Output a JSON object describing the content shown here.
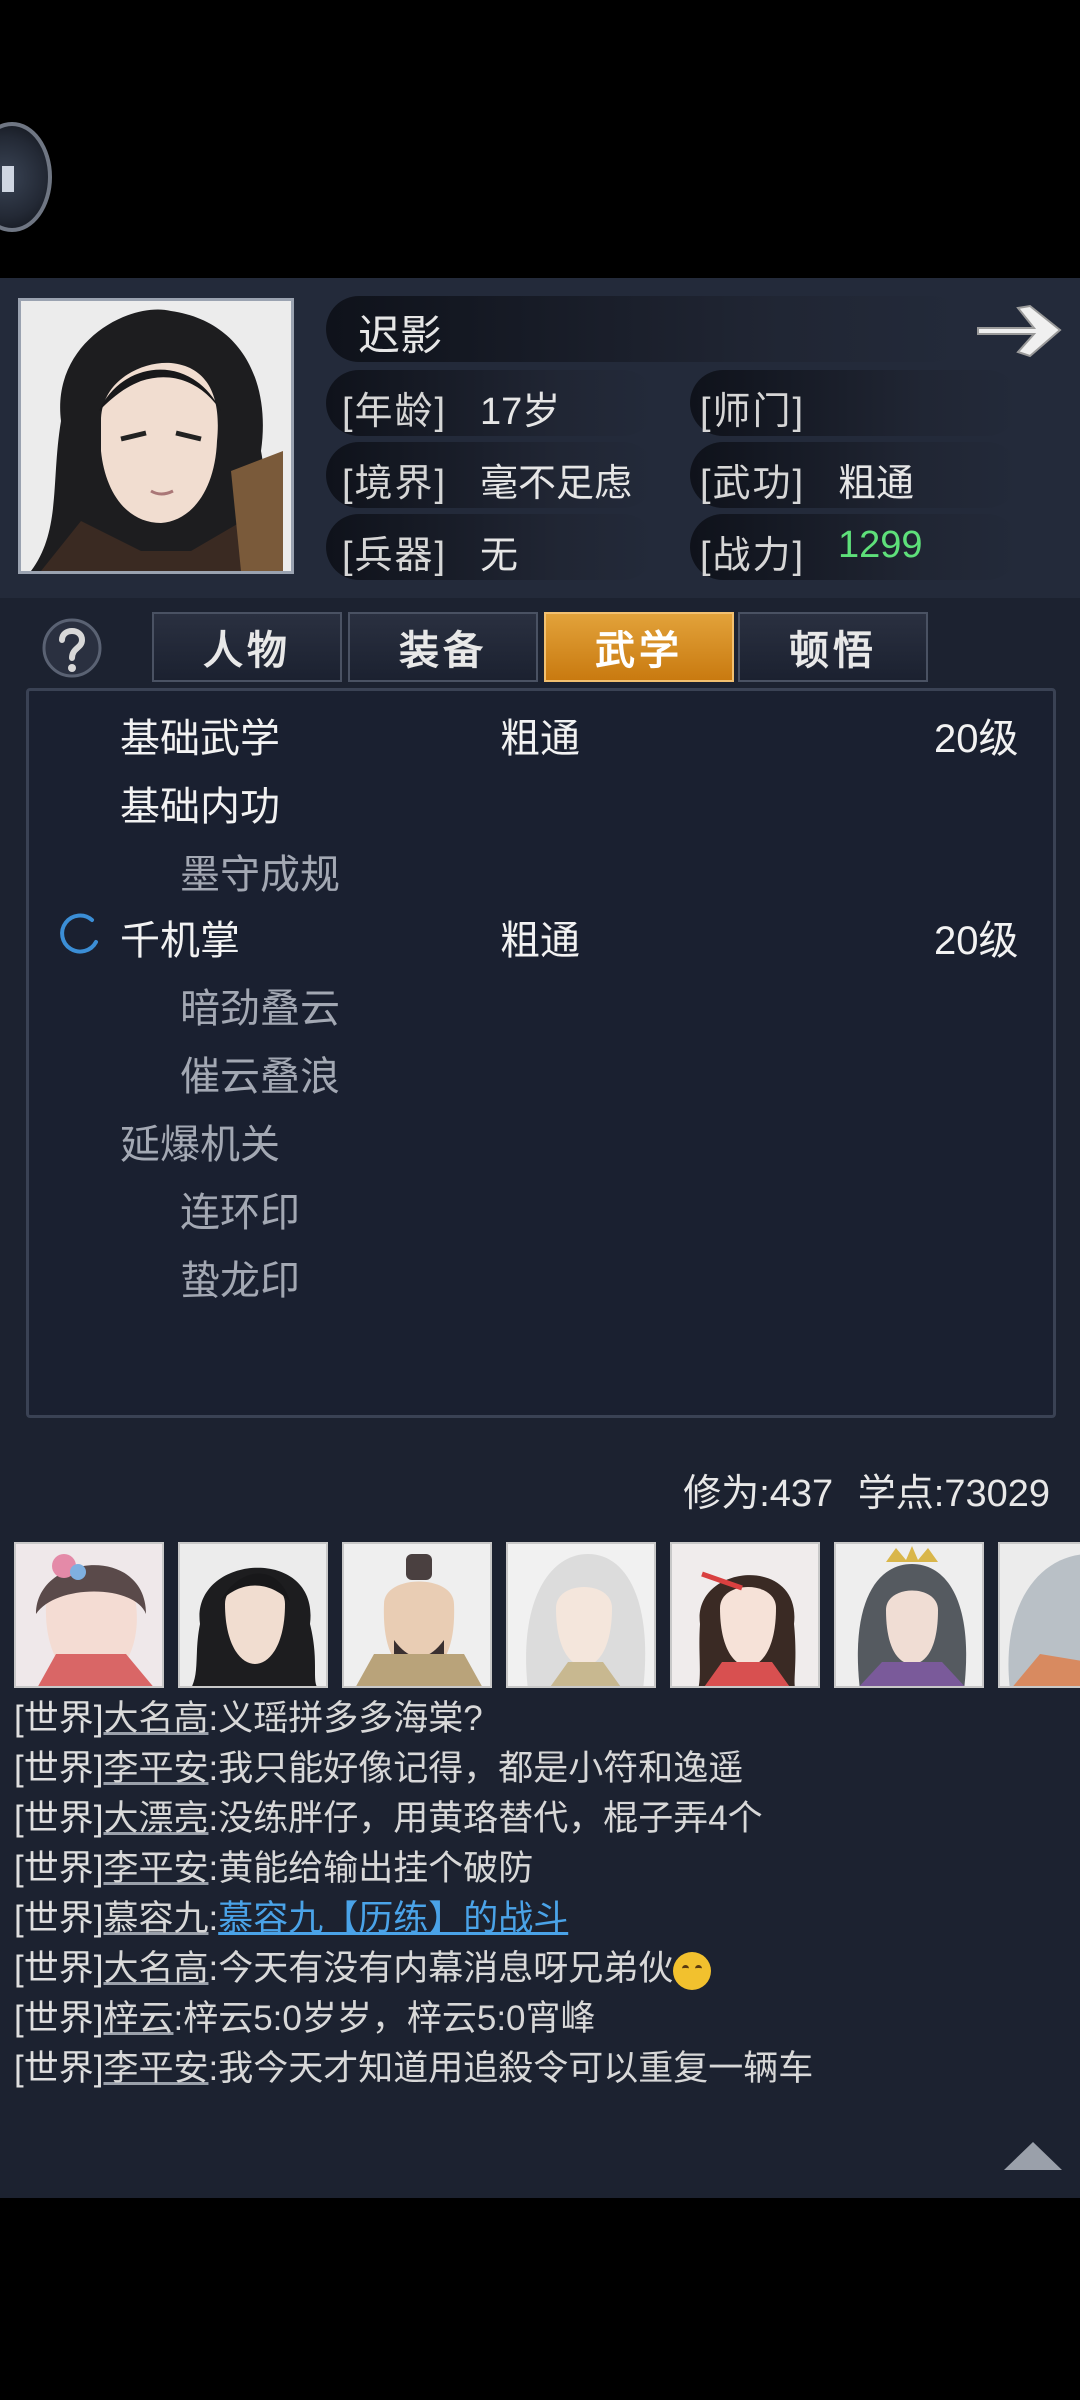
{
  "character": {
    "name": "迟影",
    "age_label": "[年龄]",
    "age_value": "17岁",
    "sect_label": "[师门]",
    "sect_value": "",
    "realm_label": "[境界]",
    "realm_value": "毫不足虑",
    "martial_label": "[武功]",
    "martial_value": "粗通",
    "weapon_label": "[兵器]",
    "weapon_value": "无",
    "power_label": "[战力]",
    "power_value": "1299"
  },
  "tabs": [
    {
      "label": "人物",
      "active": false
    },
    {
      "label": "装备",
      "active": false
    },
    {
      "label": "武学",
      "active": true
    },
    {
      "label": "顿悟",
      "active": false
    }
  ],
  "skills": [
    {
      "name": "基础武学",
      "level_text": "粗通",
      "grade": "20级",
      "type": "main"
    },
    {
      "name": "基础内功",
      "level_text": "",
      "grade": "",
      "type": "main"
    },
    {
      "name": "墨守成规",
      "level_text": "",
      "grade": "",
      "type": "sub"
    },
    {
      "name": "千机掌",
      "level_text": "粗通",
      "grade": "20级",
      "type": "main",
      "icon": "loading-spinner-icon"
    },
    {
      "name": "暗劲叠云",
      "level_text": "",
      "grade": "",
      "type": "sub"
    },
    {
      "name": "催云叠浪",
      "level_text": "",
      "grade": "",
      "type": "sub"
    },
    {
      "name": "延爆机关",
      "level_text": "",
      "grade": "",
      "type": "sub-main"
    },
    {
      "name": "连环印",
      "level_text": "",
      "grade": "",
      "type": "sub"
    },
    {
      "name": "蛰龙印",
      "level_text": "",
      "grade": "",
      "type": "sub"
    }
  ],
  "stats": {
    "cultivation": "修为:437",
    "points": "学点:73029"
  },
  "chat": [
    {
      "channel": "[世界]",
      "name": "大名高",
      "text": ":义瑶拼多多海棠?"
    },
    {
      "channel": "[世界]",
      "name": "李平安",
      "text": ":我只能好像记得，都是小符和逸遥"
    },
    {
      "channel": "[世界]",
      "name": "大漂亮",
      "text": ":没练胖仔，用黄珞替代，棍子弄4个"
    },
    {
      "channel": "[世界]",
      "name": "李平安",
      "text": ":黄能给输出挂个破防"
    },
    {
      "channel": "[世界]",
      "name": "慕容九",
      "text": ":",
      "link": "慕容九【历练】的战斗"
    },
    {
      "channel": "[世界]",
      "name": "大名高",
      "text": ":今天有没有内幕消息呀兄弟伙",
      "emoji": "grinning-face-icon"
    },
    {
      "channel": "[世界]",
      "name": "梓云",
      "text": ":梓云5:0岁岁，梓云5:0宵峰"
    },
    {
      "channel": "[世界]",
      "name": "李平安",
      "text": ":我今天才知道用追殺令可以重复一辆车"
    }
  ],
  "colors": {
    "panel_bg": "#1c2230",
    "active_tab": "#d98c1e",
    "power_green": "#5ee07a",
    "link_blue": "#4aa3e8"
  }
}
